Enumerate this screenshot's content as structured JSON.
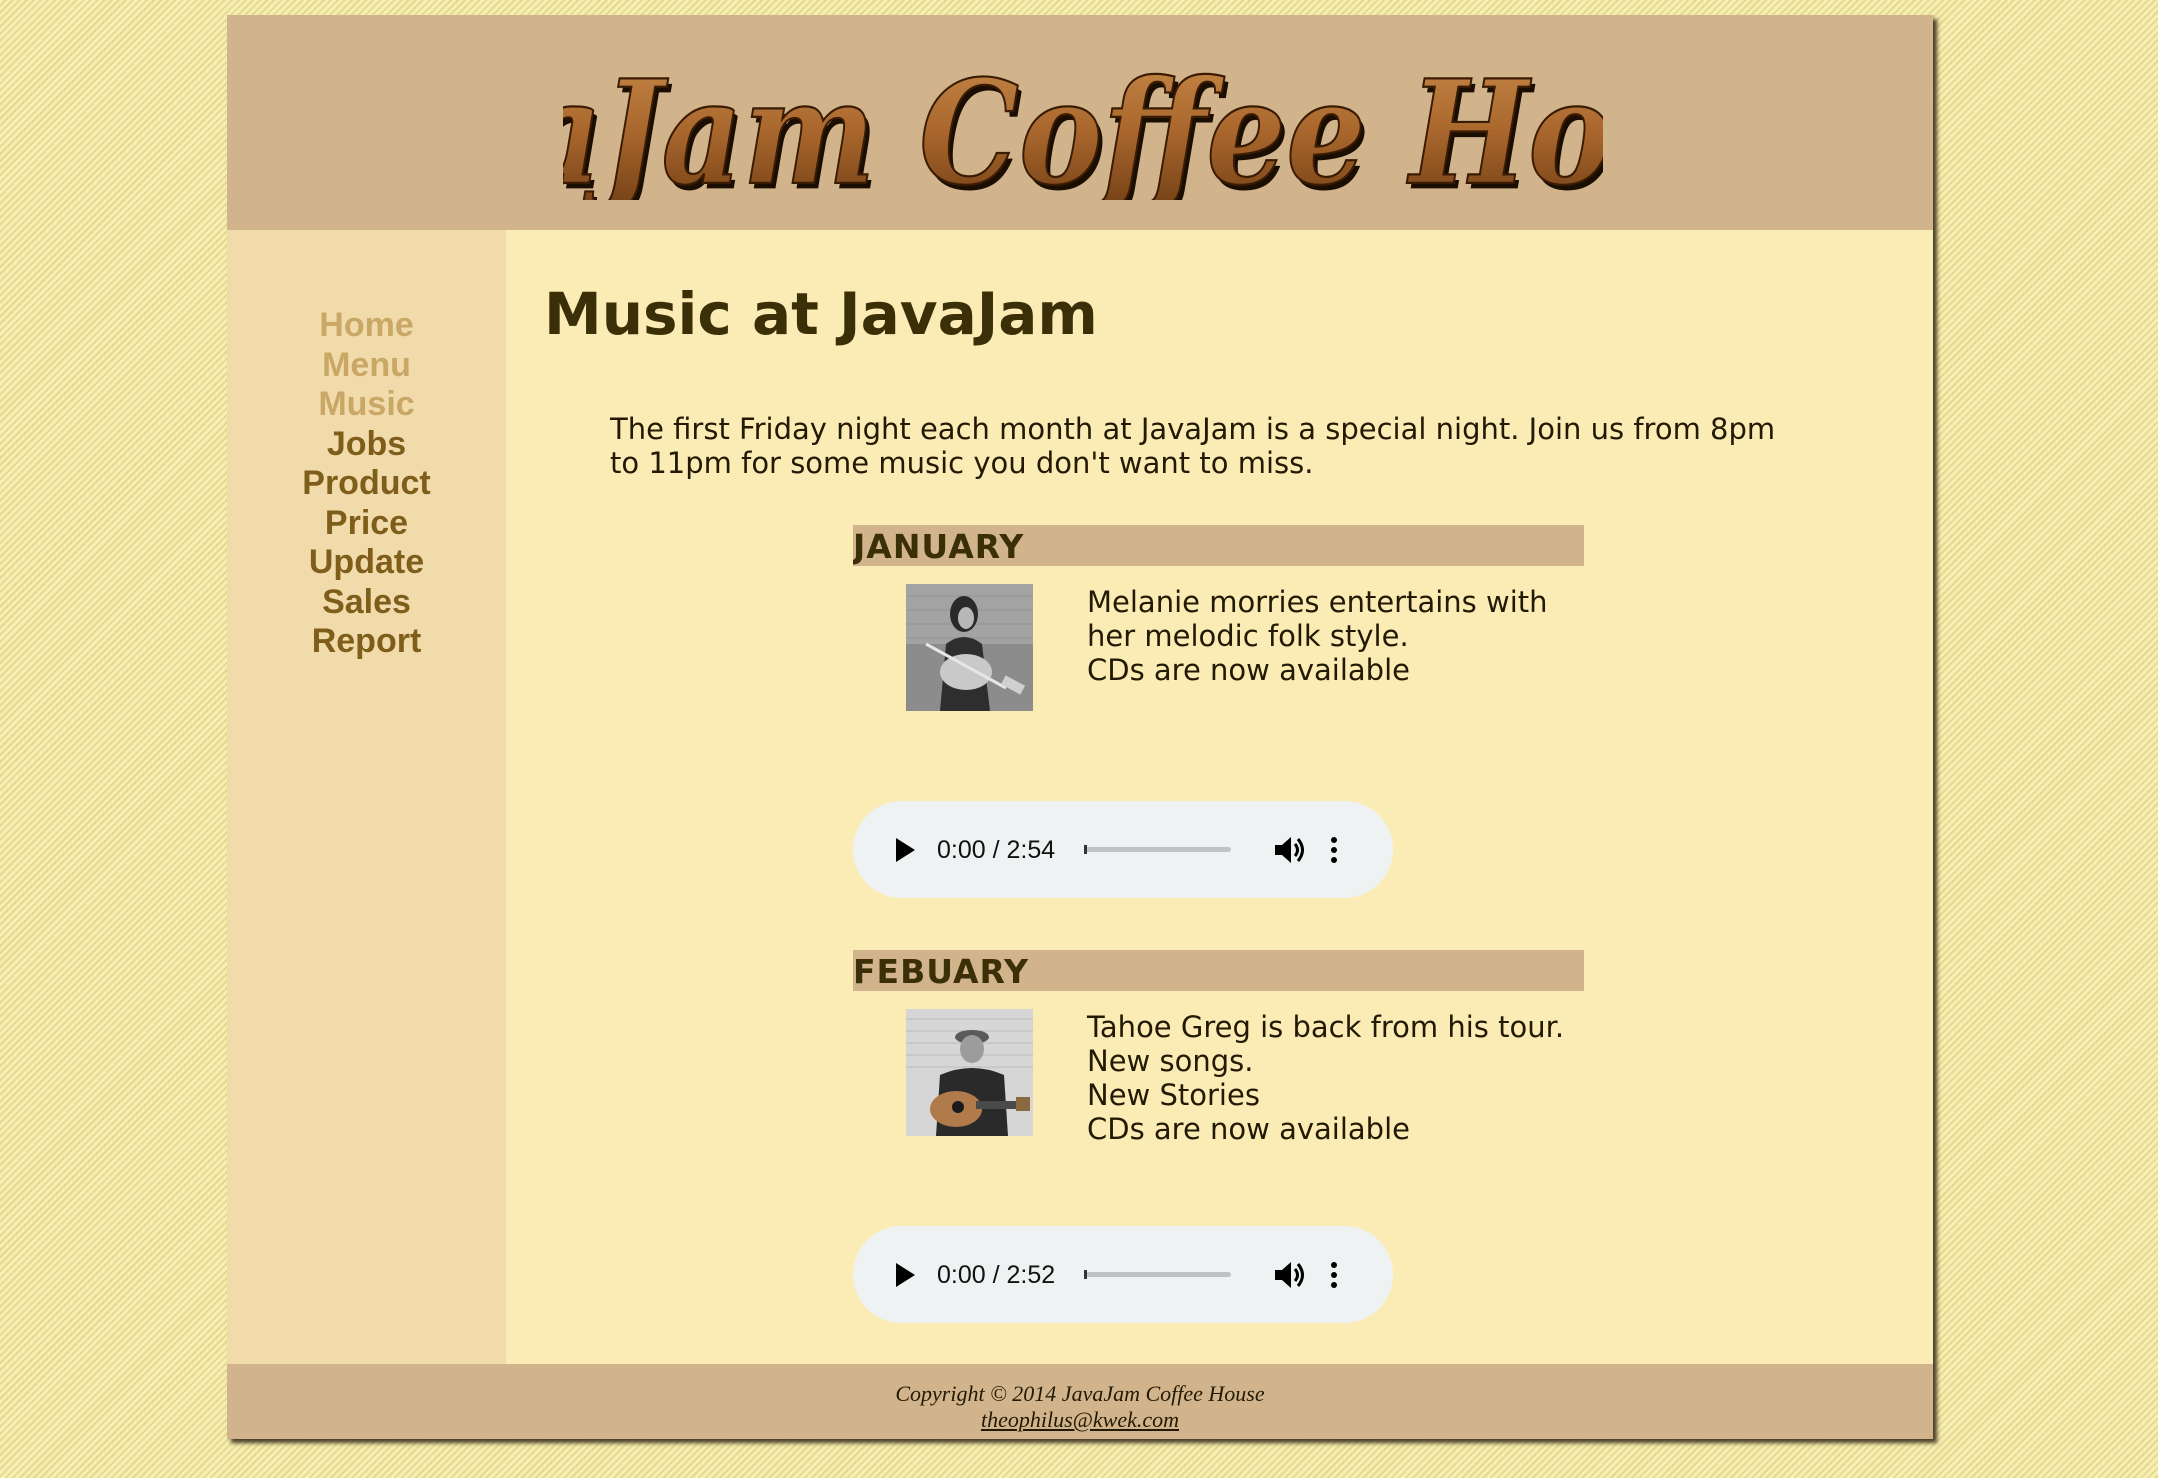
{
  "header": {
    "logo_text": "JavaJam Coffee House"
  },
  "nav": {
    "items": [
      {
        "label": "Home",
        "visited": true
      },
      {
        "label": "Menu",
        "visited": true
      },
      {
        "label": "Music",
        "visited": true
      },
      {
        "label": "Jobs",
        "visited": false
      },
      {
        "label": "Product",
        "visited": false
      },
      {
        "label": "Price",
        "visited": false
      },
      {
        "label": "Update",
        "visited": false
      },
      {
        "label": "Sales",
        "visited": false
      },
      {
        "label": "Report",
        "visited": false
      }
    ],
    "visited_color": "#c9a766",
    "link_color": "#7f5e1c"
  },
  "main": {
    "title": "Music at JavaJam",
    "intro": "The first Friday night each month at JavaJam is a special night. Join us from 8pm to 11pm for some music you don't want to miss.",
    "events": [
      {
        "month": "JANUARY",
        "photo_icon": "guitarist-photo",
        "lines": [
          "Melanie morries entertains with",
          "her melodic folk style.",
          "CDs are now available"
        ],
        "audio": {
          "time": "0:00 / 2:54",
          "progress": 0
        }
      },
      {
        "month": "FEBUARY",
        "photo_icon": "guitarist-photo",
        "lines": [
          "Tahoe Greg is back from his tour.",
          "New songs.",
          "New Stories",
          "CDs are now available"
        ],
        "audio": {
          "time": "0:00 / 2:52",
          "progress": 0
        }
      }
    ]
  },
  "footer": {
    "copyright": "Copyright © 2014 JavaJam Coffee House",
    "email": "theophilus@kwek.com"
  },
  "colors": {
    "header_bg": "#d2b48c",
    "nav_bg": "#f1dbaa",
    "content_bg": "#faecb4",
    "heading_text": "#3b2f08"
  }
}
